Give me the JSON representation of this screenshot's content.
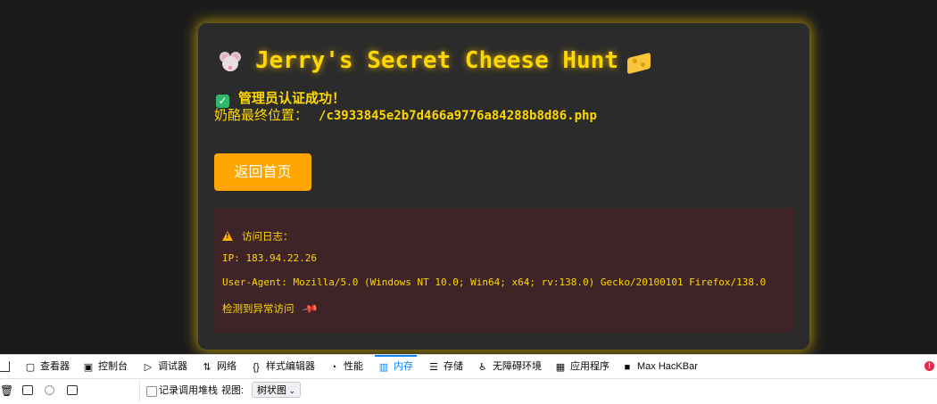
{
  "page": {
    "title": "Jerry's Secret Cheese Hunt",
    "auth_message": "管理员认证成功！",
    "location_label": "奶酪最终位置：",
    "location_path": "/c3933845e2b7d466a9776a84288b8d86.php",
    "home_button": "返回首页",
    "log": {
      "heading": "访问日志：",
      "ip": "IP: 183.94.22.26",
      "user_agent": "User-Agent: Mozilla/5.0 (Windows NT 10.0; Win64; x64; rv:138.0) Gecko/20100101 Firefox/138.0",
      "anomaly": "检测到异常访问"
    },
    "colors": {
      "accent": "#ffd700",
      "button": "#ffa500",
      "log_bg": "#3e2426",
      "card_bg": "#2b2b2b"
    }
  },
  "devtools": {
    "tabs": [
      {
        "label": "查看器",
        "icon": "inspector-icon"
      },
      {
        "label": "控制台",
        "icon": "console-icon"
      },
      {
        "label": "调试器",
        "icon": "debugger-icon"
      },
      {
        "label": "网络",
        "icon": "network-icon"
      },
      {
        "label": "样式编辑器",
        "icon": "style-editor-icon"
      },
      {
        "label": "性能",
        "icon": "performance-icon"
      },
      {
        "label": "内存",
        "icon": "memory-icon",
        "selected": true
      },
      {
        "label": "存储",
        "icon": "storage-icon"
      },
      {
        "label": "无障碍环境",
        "icon": "accessibility-icon"
      },
      {
        "label": "应用程序",
        "icon": "application-icon"
      },
      {
        "label": "Max HacKBar",
        "icon": "hackbar-icon"
      }
    ],
    "record_stack_label": "记录调用堆栈",
    "view_label": "视图:",
    "view_value": "树状图"
  }
}
